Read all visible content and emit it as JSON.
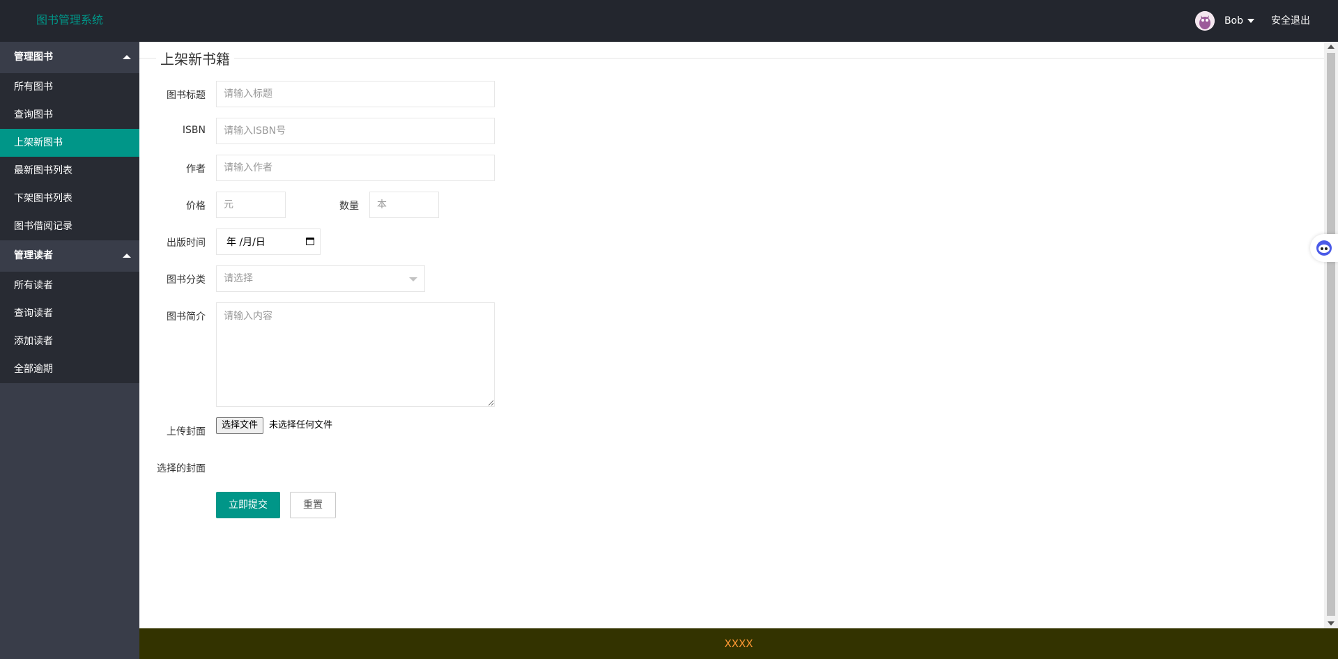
{
  "header": {
    "logo": "图书管理系统",
    "user_name": "Bob",
    "logout": "安全退出"
  },
  "sidebar": {
    "groups": [
      {
        "title": "管理图书",
        "items": [
          "所有图书",
          "查询图书",
          "上架新图书",
          "最新图书列表",
          "下架图书列表",
          "图书借阅记录"
        ]
      },
      {
        "title": "管理读者",
        "items": [
          "所有读者",
          "查询读者",
          "添加读者",
          "全部逾期"
        ]
      }
    ],
    "active_item": "上架新图书"
  },
  "form": {
    "legend": "上架新书籍",
    "title_label": "图书标题",
    "title_placeholder": "请输入标题",
    "isbn_label": "ISBN",
    "isbn_placeholder": "请输入ISBN号",
    "author_label": "作者",
    "author_placeholder": "请输入作者",
    "price_label": "价格",
    "price_placeholder": "元",
    "quantity_label": "数量",
    "quantity_placeholder": "本",
    "pubdate_label": "出版时间",
    "pubdate_value": "年 /月/日",
    "category_label": "图书分类",
    "category_placeholder": "请选择",
    "intro_label": "图书简介",
    "intro_placeholder": "请输入内容",
    "cover_label": "上传封面",
    "file_button": "选择文件",
    "file_status": "未选择任何文件",
    "selected_cover_label": "选择的封面",
    "submit": "立即提交",
    "reset": "重置"
  },
  "footer": {
    "text": "XXXX"
  },
  "colors": {
    "accent": "#009688",
    "header_bg": "#23262e",
    "sidebar_bg": "#393d49",
    "sidebar_list_bg": "#282b33",
    "footer_bg": "#333300",
    "footer_text": "#ff9933"
  }
}
